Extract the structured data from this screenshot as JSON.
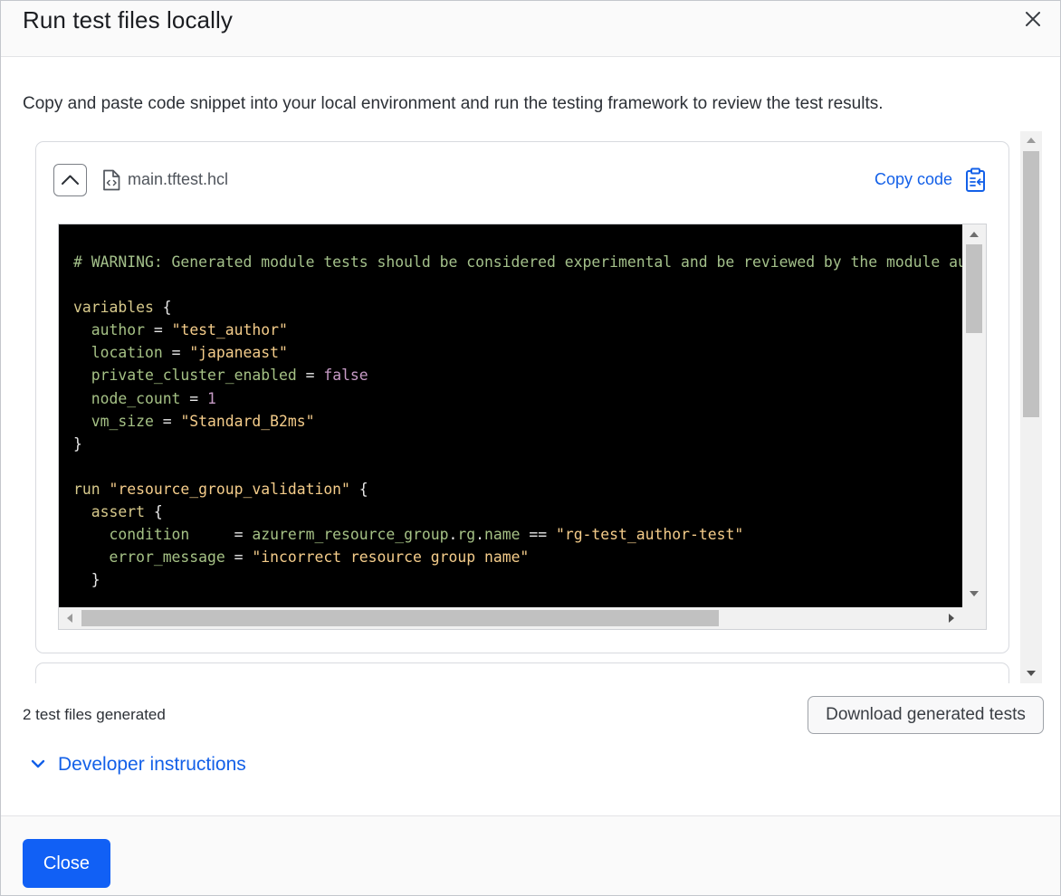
{
  "modal": {
    "title": "Run test files locally",
    "intro": "Copy and paste code snippet into your local environment and run the testing framework to review the test results."
  },
  "file": {
    "name": "main.tftest.hcl",
    "copy_label": "Copy code"
  },
  "code": {
    "warning_prefix": "# ",
    "warning_text": "WARNING: Generated module tests should be considered experimental and be reviewed by the module au",
    "variables_kw": "variables",
    "vars": [
      {
        "key": "author",
        "value": "\"test_author\"",
        "kind": "str"
      },
      {
        "key": "location",
        "value": "\"japaneast\"",
        "kind": "str"
      },
      {
        "key": "private_cluster_enabled",
        "value": "false",
        "kind": "bool"
      },
      {
        "key": "node_count",
        "value": "1",
        "kind": "num"
      },
      {
        "key": "vm_size",
        "value": "\"Standard_B2ms\"",
        "kind": "str"
      }
    ],
    "run_kw": "run",
    "run_name": "\"resource_group_validation\"",
    "assert_kw": "assert",
    "condition_key": "condition",
    "condition_ref_a": "azurerm_resource_group",
    "condition_ref_b": "rg",
    "condition_ref_c": "name",
    "condition_value": "\"rg-test_author-test\"",
    "error_key": "error_message",
    "error_value": "\"incorrect resource group name\""
  },
  "footer_info": {
    "count": "2 test files generated",
    "download_label": "Download generated tests",
    "dev_instructions": "Developer instructions"
  },
  "footer": {
    "close_label": "Close"
  },
  "colors": {
    "accent": "#1360e8",
    "primary_button": "#1160f5",
    "code_bg": "#000000"
  }
}
